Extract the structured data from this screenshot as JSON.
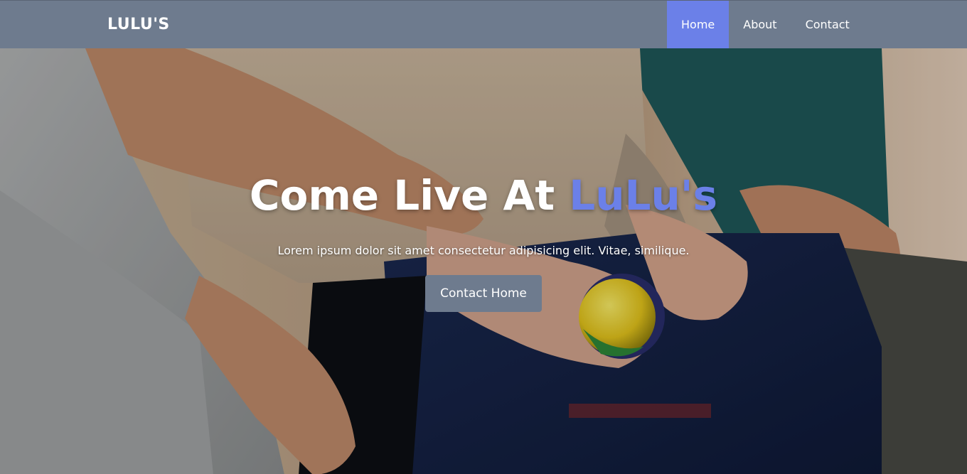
{
  "brand": {
    "name": "LULU'S"
  },
  "nav": {
    "items": [
      {
        "label": "Home",
        "active": true
      },
      {
        "label": "About",
        "active": false
      },
      {
        "label": "Contact",
        "active": false
      }
    ]
  },
  "hero": {
    "title_main": "Come Live At ",
    "title_accent": "LuLu's",
    "subtitle": "Lorem ipsum dolor sit amet consectetur adipisicing elit. Vitae, similique.",
    "button_label": "Contact Home"
  },
  "colors": {
    "navbar": "#6e7b8e",
    "accent": "#6b80e8",
    "button": "#6e7b8e",
    "text": "#ffffff"
  }
}
